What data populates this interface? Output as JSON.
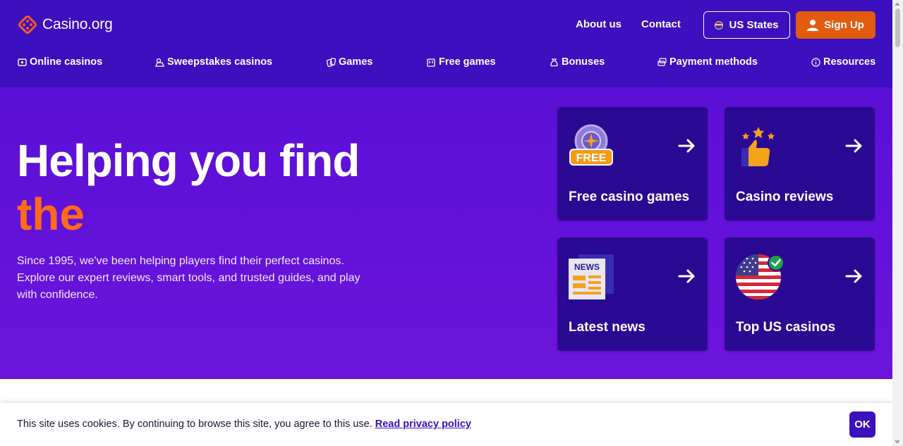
{
  "header": {
    "logo_text": "Casino.org",
    "links": {
      "about": "About us",
      "contact": "Contact"
    },
    "states_button": "US States",
    "signup_button": "Sign Up"
  },
  "nav": {
    "items": [
      {
        "label": "Online casinos",
        "icon": "casino-icon"
      },
      {
        "label": "Sweepstakes casinos",
        "icon": "sweepstakes-icon"
      },
      {
        "label": "Games",
        "icon": "cards-icon"
      },
      {
        "label": "Free games",
        "icon": "slot-machine-icon"
      },
      {
        "label": "Bonuses",
        "icon": "money-bag-icon"
      },
      {
        "label": "Payment methods",
        "icon": "payment-icon"
      },
      {
        "label": "Resources",
        "icon": "info-icon"
      }
    ]
  },
  "hero": {
    "title_line1": "Helping you find",
    "title_line2": "the",
    "description": "Since 1995, we've been helping players find their perfect casinos. Explore our expert reviews, smart tools, and trusted guides, and play with confidence."
  },
  "cards": [
    {
      "title": "Free casino games",
      "icon": "free-chip-icon",
      "badge": "FREE"
    },
    {
      "title": "Casino reviews",
      "icon": "thumbs-up-stars-icon"
    },
    {
      "title": "Latest news",
      "icon": "newspaper-icon",
      "badge": "NEWS"
    },
    {
      "title": "Top US casinos",
      "icon": "us-flag-check-icon"
    }
  ],
  "cookie": {
    "text": "This site uses cookies. By continuing to browse this site, you agree to this use.",
    "link": "Read privacy policy",
    "ok": "OK"
  },
  "colors": {
    "header_bg": "#3c0fbf",
    "hero_bg": "#6312d8",
    "card_bg": "#2a0a93",
    "accent_orange": "#e25c10",
    "title_accent": "#ff6a1a"
  }
}
